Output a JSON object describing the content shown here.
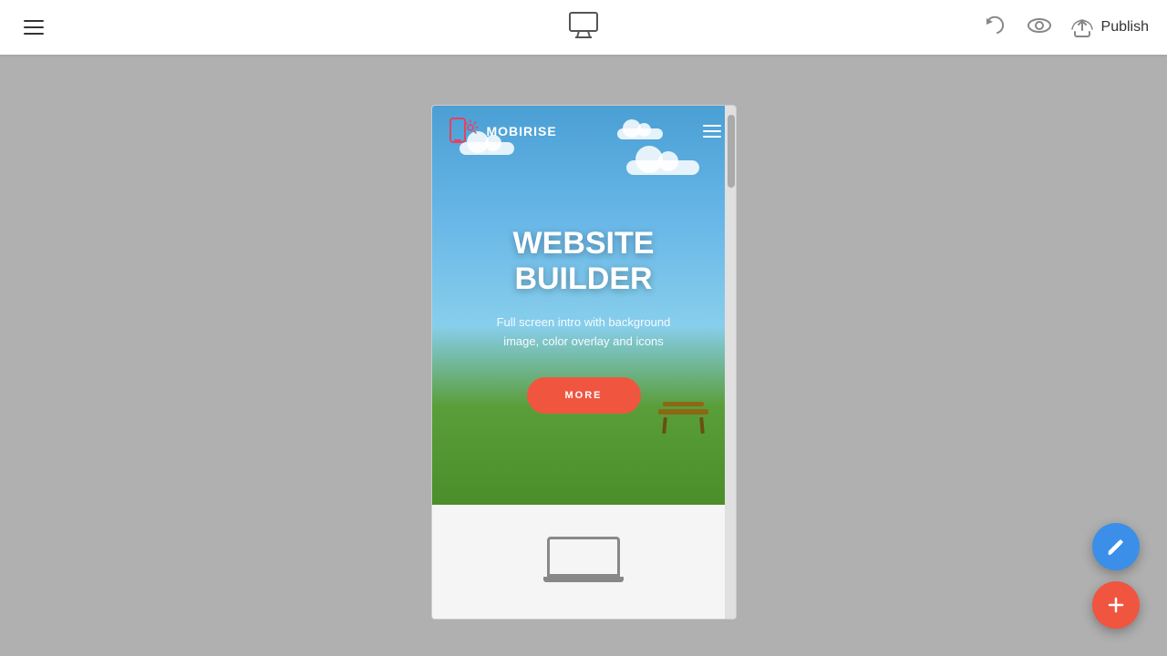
{
  "toolbar": {
    "publish_label": "Publish"
  },
  "preview": {
    "nav": {
      "logo_text": "MOBIRISE",
      "hamburger_label": "Menu"
    },
    "hero": {
      "title_line1": "WEBSITE",
      "title_line2": "BUILDER",
      "subtitle": "Full screen intro with background image, color overlay and icons",
      "cta_label": "MORE"
    }
  },
  "fab": {
    "edit_label": "Edit",
    "add_label": "Add"
  }
}
